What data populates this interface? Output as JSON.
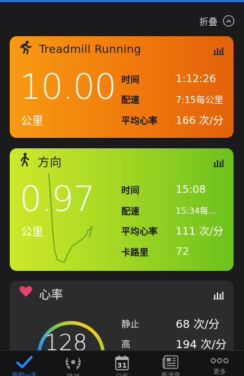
{
  "header": {
    "collapse_label": "折叠"
  },
  "colors": {
    "orange": "#f07a0c",
    "green": "#a7d924",
    "heart": "#e9426a",
    "active_tab": "#2a86ff"
  },
  "cards": [
    {
      "title": "Treadmill Running",
      "icon": "running-person-icon",
      "value": "10.00",
      "unit": "公里",
      "stats": [
        {
          "label": "时间",
          "value": "1:12:26"
        },
        {
          "label": "配速",
          "value": "7:15每公里"
        },
        {
          "label": "平均心率",
          "value": "166 次/分"
        }
      ]
    },
    {
      "title": "方向",
      "icon": "walking-person-icon",
      "value": "0.97",
      "unit": "公里",
      "stats": [
        {
          "label": "时间",
          "value": "15:08"
        },
        {
          "label": "配速",
          "value": "15:34每…"
        },
        {
          "label": "平均心率",
          "value": "111 次/分"
        },
        {
          "label": "卡路里",
          "value": "72"
        }
      ]
    },
    {
      "title": "心率",
      "icon": "heart-icon",
      "value": "128",
      "stats": [
        {
          "label": "静止",
          "value": "68 次/分"
        },
        {
          "label": "高",
          "value": "194 次/分"
        }
      ]
    }
  ],
  "tabs": [
    {
      "label": "我的一天",
      "icon": "checkmark-icon",
      "active": true
    },
    {
      "label": "挑战",
      "icon": "laurel-icon",
      "active": false
    },
    {
      "label": "日历",
      "icon": "calendar-icon",
      "day": "31",
      "active": false
    },
    {
      "label": "新消息",
      "icon": "newsfeed-icon",
      "active": false
    },
    {
      "label": "更多",
      "icon": "more-dots-icon",
      "active": false
    }
  ]
}
